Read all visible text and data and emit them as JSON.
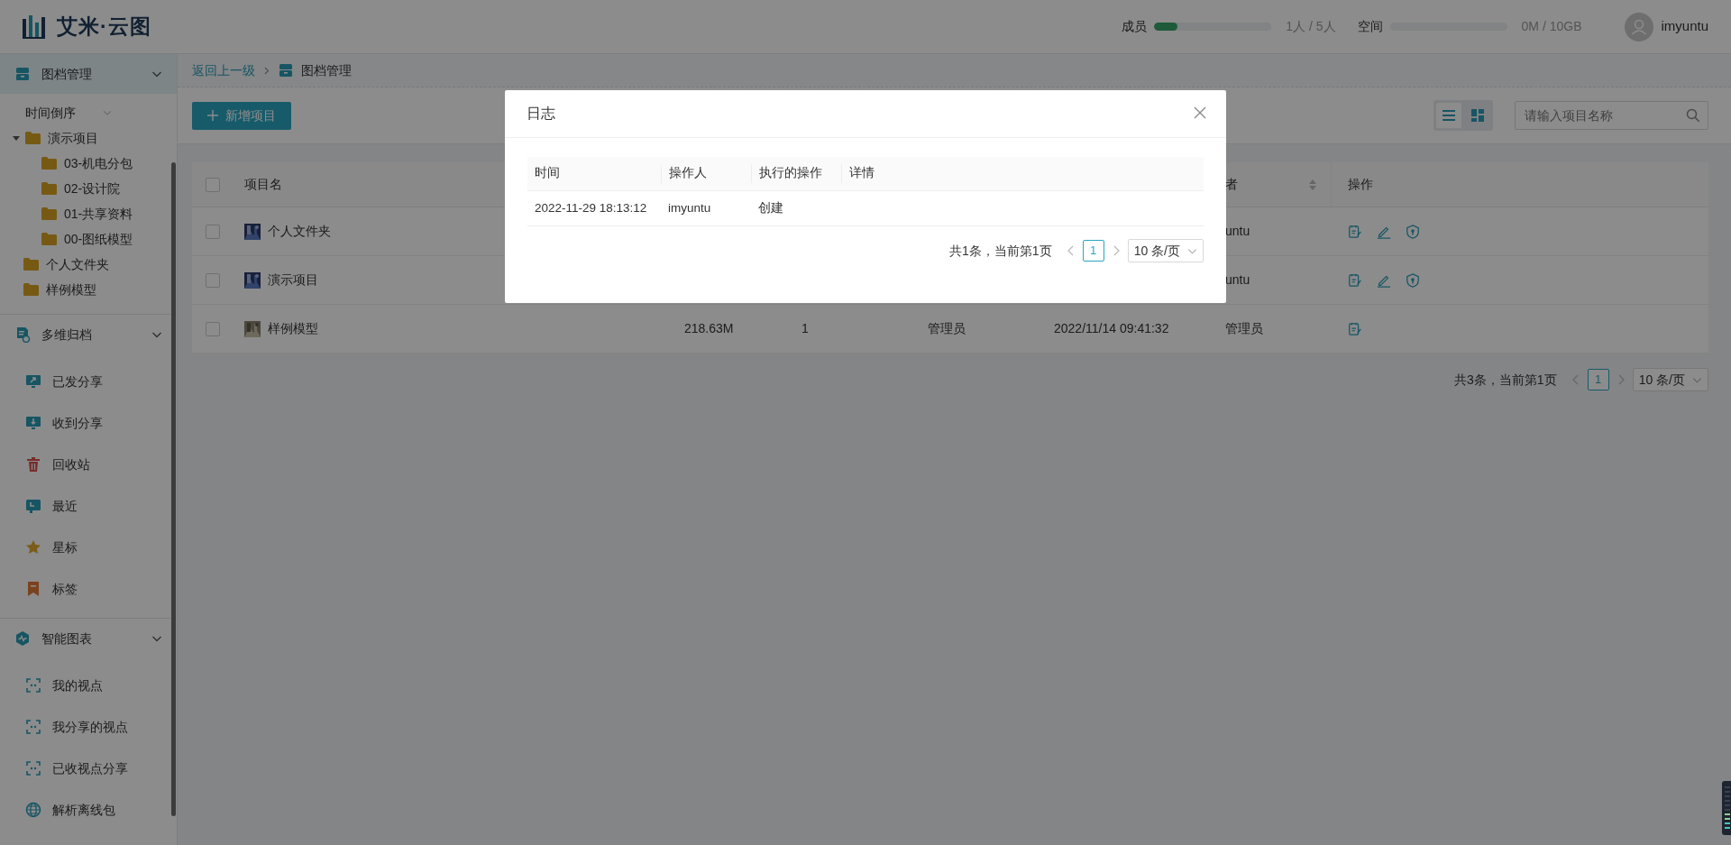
{
  "header": {
    "logo_text": "艾米·云图",
    "members": {
      "label": "成员",
      "level": 0.2,
      "reading": "1人 / 5人"
    },
    "space": {
      "label": "空间",
      "reading": "0M / 10GB"
    },
    "user": "imyuntu"
  },
  "sidebar": {
    "sections": [
      {
        "title": "图档管理",
        "kind": "drawer",
        "expanded": true,
        "selected": true,
        "sort": "时间倒序",
        "tree": [
          {
            "label": "演示项目",
            "expanded": true,
            "children": [
              {
                "label": "03-机电分包"
              },
              {
                "label": "02-设计院"
              },
              {
                "label": "01-共享资料"
              },
              {
                "label": "00-图纸模型"
              }
            ]
          },
          {
            "label": "个人文件夹"
          },
          {
            "label": "样例模型"
          }
        ]
      },
      {
        "title": "多维归档",
        "kind": "archive",
        "expanded": true,
        "selected": false,
        "items": [
          {
            "label": "已发分享",
            "kind": "sent"
          },
          {
            "label": "收到分享",
            "kind": "received"
          },
          {
            "label": "回收站",
            "kind": "trash"
          },
          {
            "label": "最近",
            "kind": "recent"
          },
          {
            "label": "星标",
            "kind": "star"
          },
          {
            "label": "标签",
            "kind": "bookmark"
          }
        ]
      },
      {
        "title": "智能图表",
        "kind": "chart",
        "expanded": true,
        "selected": false,
        "items": [
          {
            "label": "我的视点",
            "kind": "focus"
          },
          {
            "label": "我分享的视点",
            "kind": "focus"
          },
          {
            "label": "已收视点分享",
            "kind": "focus"
          },
          {
            "label": "解析离线包",
            "kind": "globe"
          }
        ]
      }
    ]
  },
  "breadcrumb": {
    "back": "返回上一级",
    "current": "图档管理"
  },
  "toolbar": {
    "add_button": "新增项目",
    "views": [
      {
        "kind": "list",
        "selected": true
      },
      {
        "kind": "grid",
        "selected": false
      }
    ],
    "search": {
      "placeholder": "请输入项目名称"
    }
  },
  "table": {
    "all_checked": false,
    "name_column": "项目名",
    "creator_column": "者",
    "actions_column": "操作",
    "rows": [
      {
        "checked": false,
        "name": "个人文件夹",
        "creator": "untu",
        "actions": [
          {
            "kind": "log"
          },
          {
            "kind": "edit"
          },
          {
            "kind": "permission"
          }
        ]
      },
      {
        "checked": false,
        "name": "演示项目",
        "creator": "untu",
        "actions": [
          {
            "kind": "log"
          },
          {
            "kind": "edit"
          },
          {
            "kind": "permission"
          }
        ]
      },
      {
        "checked": false,
        "name": "样例模型",
        "size": "218.63M",
        "count": "1",
        "role": "管理员",
        "date": "2022/11/14 09:41:32",
        "creator": "管理员",
        "actions": [
          {
            "kind": "log"
          }
        ]
      }
    ]
  },
  "pagination": {
    "summary": "共3条，当前第1页",
    "pages": [
      {
        "label": "1",
        "selected": true
      }
    ],
    "page_size": "10 条/页"
  },
  "modal": {
    "title": "日志",
    "columns": [
      "时间",
      "操作人",
      "执行的操作",
      "详情"
    ],
    "rows": [
      {
        "time": "2022-11-29 18:13:12",
        "operator": "imyuntu",
        "action": "创建"
      }
    ],
    "pagination": {
      "summary": "共1条，当前第1页",
      "pages": [
        {
          "label": "1",
          "selected": true
        }
      ],
      "page_size": "10 条/页"
    }
  }
}
